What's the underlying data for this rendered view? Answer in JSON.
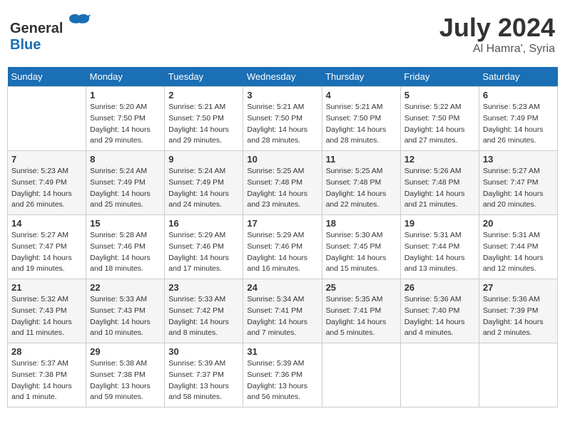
{
  "header": {
    "logo_general": "General",
    "logo_blue": "Blue",
    "month_year": "July 2024",
    "location": "Al Hamra', Syria"
  },
  "weekdays": [
    "Sunday",
    "Monday",
    "Tuesday",
    "Wednesday",
    "Thursday",
    "Friday",
    "Saturday"
  ],
  "weeks": [
    [
      {
        "day": "",
        "info": ""
      },
      {
        "day": "1",
        "info": "Sunrise: 5:20 AM\nSunset: 7:50 PM\nDaylight: 14 hours\nand 29 minutes."
      },
      {
        "day": "2",
        "info": "Sunrise: 5:21 AM\nSunset: 7:50 PM\nDaylight: 14 hours\nand 29 minutes."
      },
      {
        "day": "3",
        "info": "Sunrise: 5:21 AM\nSunset: 7:50 PM\nDaylight: 14 hours\nand 28 minutes."
      },
      {
        "day": "4",
        "info": "Sunrise: 5:21 AM\nSunset: 7:50 PM\nDaylight: 14 hours\nand 28 minutes."
      },
      {
        "day": "5",
        "info": "Sunrise: 5:22 AM\nSunset: 7:50 PM\nDaylight: 14 hours\nand 27 minutes."
      },
      {
        "day": "6",
        "info": "Sunrise: 5:23 AM\nSunset: 7:49 PM\nDaylight: 14 hours\nand 26 minutes."
      }
    ],
    [
      {
        "day": "7",
        "info": "Sunrise: 5:23 AM\nSunset: 7:49 PM\nDaylight: 14 hours\nand 26 minutes."
      },
      {
        "day": "8",
        "info": "Sunrise: 5:24 AM\nSunset: 7:49 PM\nDaylight: 14 hours\nand 25 minutes."
      },
      {
        "day": "9",
        "info": "Sunrise: 5:24 AM\nSunset: 7:49 PM\nDaylight: 14 hours\nand 24 minutes."
      },
      {
        "day": "10",
        "info": "Sunrise: 5:25 AM\nSunset: 7:48 PM\nDaylight: 14 hours\nand 23 minutes."
      },
      {
        "day": "11",
        "info": "Sunrise: 5:25 AM\nSunset: 7:48 PM\nDaylight: 14 hours\nand 22 minutes."
      },
      {
        "day": "12",
        "info": "Sunrise: 5:26 AM\nSunset: 7:48 PM\nDaylight: 14 hours\nand 21 minutes."
      },
      {
        "day": "13",
        "info": "Sunrise: 5:27 AM\nSunset: 7:47 PM\nDaylight: 14 hours\nand 20 minutes."
      }
    ],
    [
      {
        "day": "14",
        "info": "Sunrise: 5:27 AM\nSunset: 7:47 PM\nDaylight: 14 hours\nand 19 minutes."
      },
      {
        "day": "15",
        "info": "Sunrise: 5:28 AM\nSunset: 7:46 PM\nDaylight: 14 hours\nand 18 minutes."
      },
      {
        "day": "16",
        "info": "Sunrise: 5:29 AM\nSunset: 7:46 PM\nDaylight: 14 hours\nand 17 minutes."
      },
      {
        "day": "17",
        "info": "Sunrise: 5:29 AM\nSunset: 7:46 PM\nDaylight: 14 hours\nand 16 minutes."
      },
      {
        "day": "18",
        "info": "Sunrise: 5:30 AM\nSunset: 7:45 PM\nDaylight: 14 hours\nand 15 minutes."
      },
      {
        "day": "19",
        "info": "Sunrise: 5:31 AM\nSunset: 7:44 PM\nDaylight: 14 hours\nand 13 minutes."
      },
      {
        "day": "20",
        "info": "Sunrise: 5:31 AM\nSunset: 7:44 PM\nDaylight: 14 hours\nand 12 minutes."
      }
    ],
    [
      {
        "day": "21",
        "info": "Sunrise: 5:32 AM\nSunset: 7:43 PM\nDaylight: 14 hours\nand 11 minutes."
      },
      {
        "day": "22",
        "info": "Sunrise: 5:33 AM\nSunset: 7:43 PM\nDaylight: 14 hours\nand 10 minutes."
      },
      {
        "day": "23",
        "info": "Sunrise: 5:33 AM\nSunset: 7:42 PM\nDaylight: 14 hours\nand 8 minutes."
      },
      {
        "day": "24",
        "info": "Sunrise: 5:34 AM\nSunset: 7:41 PM\nDaylight: 14 hours\nand 7 minutes."
      },
      {
        "day": "25",
        "info": "Sunrise: 5:35 AM\nSunset: 7:41 PM\nDaylight: 14 hours\nand 5 minutes."
      },
      {
        "day": "26",
        "info": "Sunrise: 5:36 AM\nSunset: 7:40 PM\nDaylight: 14 hours\nand 4 minutes."
      },
      {
        "day": "27",
        "info": "Sunrise: 5:36 AM\nSunset: 7:39 PM\nDaylight: 14 hours\nand 2 minutes."
      }
    ],
    [
      {
        "day": "28",
        "info": "Sunrise: 5:37 AM\nSunset: 7:38 PM\nDaylight: 14 hours\nand 1 minute."
      },
      {
        "day": "29",
        "info": "Sunrise: 5:38 AM\nSunset: 7:38 PM\nDaylight: 13 hours\nand 59 minutes."
      },
      {
        "day": "30",
        "info": "Sunrise: 5:39 AM\nSunset: 7:37 PM\nDaylight: 13 hours\nand 58 minutes."
      },
      {
        "day": "31",
        "info": "Sunrise: 5:39 AM\nSunset: 7:36 PM\nDaylight: 13 hours\nand 56 minutes."
      },
      {
        "day": "",
        "info": ""
      },
      {
        "day": "",
        "info": ""
      },
      {
        "day": "",
        "info": ""
      }
    ]
  ]
}
